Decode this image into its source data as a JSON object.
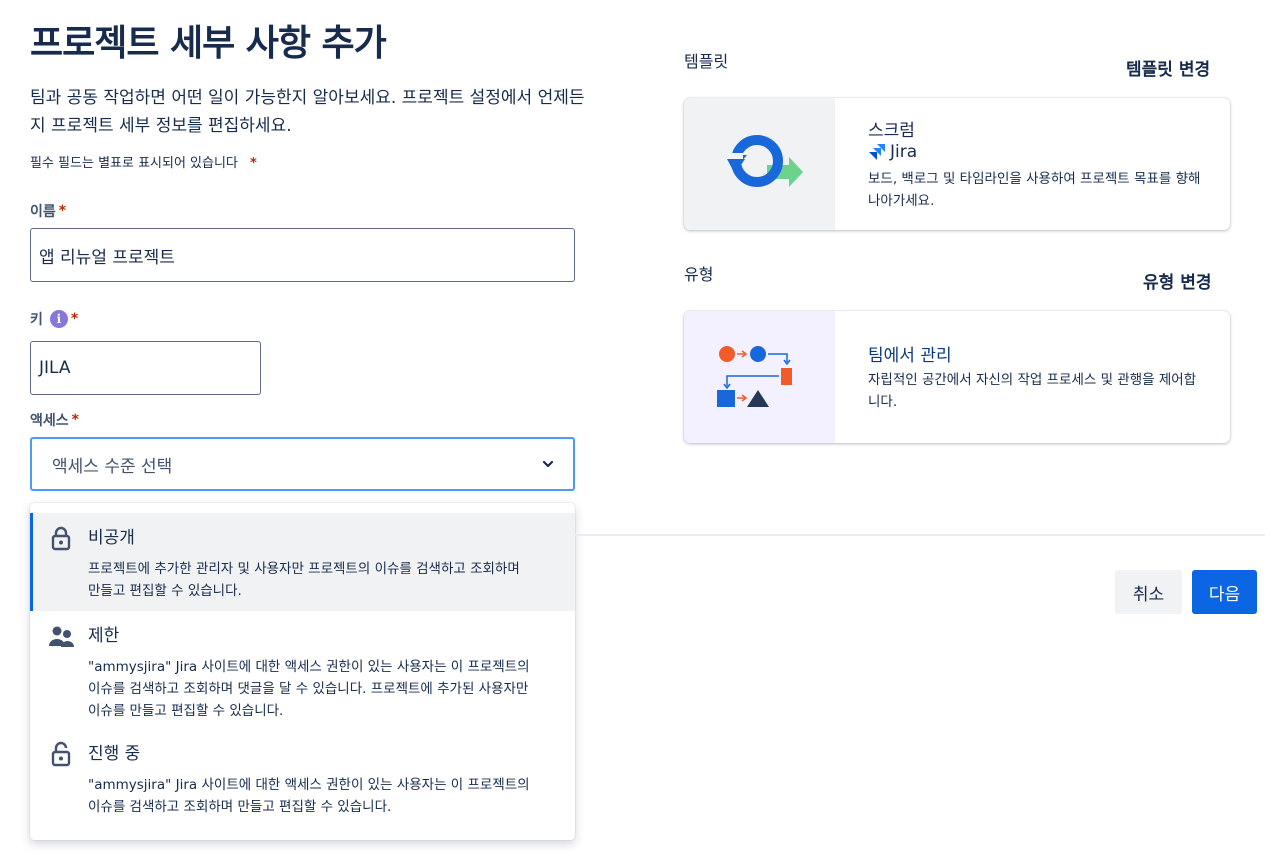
{
  "header": {
    "title": "프로젝트 세부 사항 추가",
    "description": "팀과 공동 작업하면 어떤 일이 가능한지 알아보세요. 프로젝트 설정에서 언제든지 프로젝트 세부 정보를 편집하세요.",
    "required_note": "필수 필드는 별표로 표시되어 있습니다",
    "required_star": "*"
  },
  "form": {
    "name_label": "이름",
    "name_value": "앱 리뉴얼 프로젝트",
    "key_label": "키",
    "key_info_glyph": "i",
    "key_value": "JILA",
    "access_label": "액세스",
    "access_placeholder": "액세스 수준 선택",
    "star": "*"
  },
  "access_options": [
    {
      "title": "비공개",
      "icon": "lock-icon",
      "description": "프로젝트에 추가한 관리자 및 사용자만 프로젝트의 이슈를 검색하고 조회하며 만들고 편집할 수 있습니다.",
      "selected": true
    },
    {
      "title": "제한",
      "icon": "people-icon",
      "description": "\"ammysjira\" Jira 사이트에 대한 액세스 권한이 있는 사용자는 이 프로젝트의 이슈를 검색하고 조회하며 댓글을 달 수 있습니다. 프로젝트에 추가된 사용자만 이슈를 만들고 편집할 수 있습니다.",
      "selected": false
    },
    {
      "title": "진행 중",
      "icon": "unlock-icon",
      "description": "\"ammysjira\" Jira 사이트에 대한 액세스 권한이 있는 사용자는 이 프로젝트의 이슈를 검색하고 조회하며 만들고 편집할 수 있습니다.",
      "selected": false
    }
  ],
  "template": {
    "section_label": "템플릿",
    "change_label": "템플릿 변경",
    "title": "스크럼",
    "product": "Jira",
    "description": "보드, 백로그 및 타임라인을 사용하여 프로젝트 목표를 향해 나아가세요."
  },
  "type": {
    "section_label": "유형",
    "change_label": "유형 변경",
    "title": "팀에서 관리",
    "description": "자립적인 공간에서 자신의 작업 프로세스 및 관행을 제어합니다."
  },
  "footer": {
    "cancel_label": "취소",
    "next_label": "다음"
  },
  "colors": {
    "primary": "#0c66e4",
    "required": "#bf2600",
    "focus_border": "#4c9aff"
  }
}
